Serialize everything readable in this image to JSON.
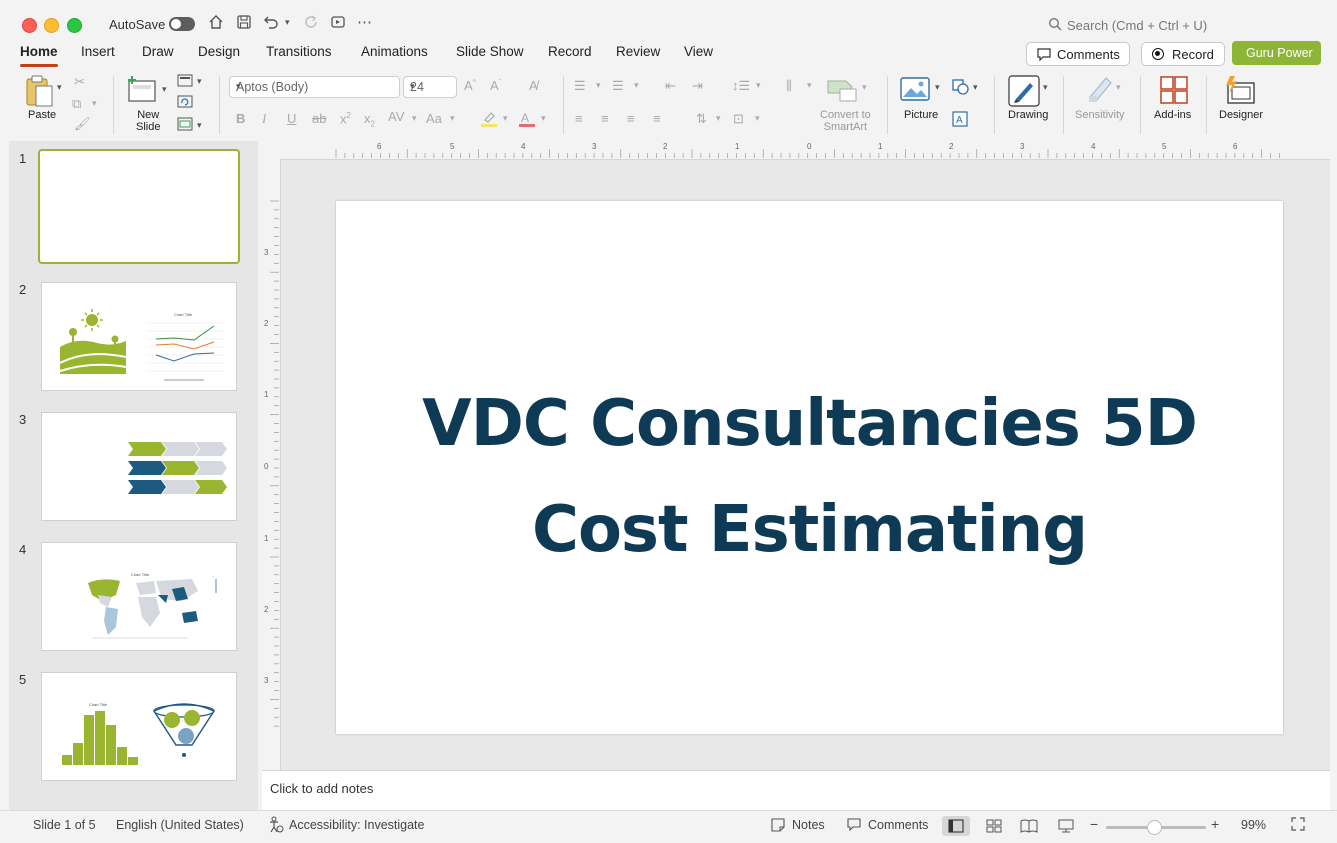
{
  "titlebar": {
    "autosave_label": "AutoSave",
    "search_placeholder": "Search (Cmd + Ctrl + U)"
  },
  "tabs": [
    {
      "label": "Home",
      "active": true
    },
    {
      "label": "Insert"
    },
    {
      "label": "Draw"
    },
    {
      "label": "Design"
    },
    {
      "label": "Transitions"
    },
    {
      "label": "Animations"
    },
    {
      "label": "Slide Show"
    },
    {
      "label": "Record"
    },
    {
      "label": "Review"
    },
    {
      "label": "View"
    }
  ],
  "header_buttons": {
    "comments": "Comments",
    "record": "Record",
    "guru": "Guru Power"
  },
  "ribbon": {
    "paste": "Paste",
    "new_slide_line1": "New",
    "new_slide_line2": "Slide",
    "font_name": "Aptos (Body)",
    "font_size": "24",
    "convert_line1": "Convert to",
    "convert_line2": "SmartArt",
    "picture": "Picture",
    "drawing": "Drawing",
    "sensitivity": "Sensitivity",
    "addins": "Add-ins",
    "designer": "Designer"
  },
  "slides_panel": {
    "numbers": [
      "1",
      "2",
      "3",
      "4",
      "5"
    ],
    "thumb2_chart_title": "Chart Title",
    "thumb4_chart_title": "Chart Title",
    "thumb5_chart_title": "Chart Title"
  },
  "ruler": {
    "top": [
      "6",
      "5",
      "4",
      "3",
      "2",
      "1",
      "0",
      "1",
      "2",
      "3",
      "4",
      "5",
      "6"
    ],
    "left": [
      "3",
      "2",
      "1",
      "0",
      "1",
      "2",
      "3"
    ]
  },
  "slide": {
    "title_line1": "VDC Consultancies 5D",
    "title_line2": "Cost Estimating"
  },
  "notes_placeholder": "Click to add notes",
  "status": {
    "slide_count": "Slide 1 of 5",
    "language": "English (United States)",
    "accessibility": "Accessibility: Investigate",
    "notes": "Notes",
    "comments": "Comments",
    "zoom": "99%"
  },
  "colors": {
    "accent_green": "#8db636",
    "title_navy": "#0e3a55",
    "home_underline": "#c43e1c",
    "thumb_blue": "#1d5a80",
    "thumb_gray": "#d5d9df"
  }
}
